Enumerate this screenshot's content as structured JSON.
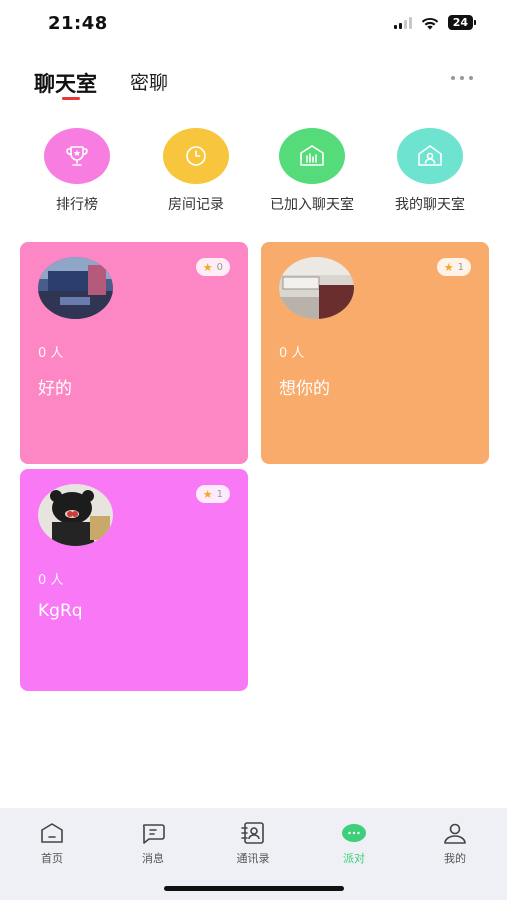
{
  "status_bar": {
    "time": "21:48",
    "battery": "24"
  },
  "header": {
    "tabs": [
      {
        "label": "聊天室"
      },
      {
        "label": "密聊"
      }
    ],
    "more_icon": "more-icon"
  },
  "quick_entries": [
    {
      "label": "排行榜",
      "icon": "trophy-icon",
      "color": "#f77ee0"
    },
    {
      "label": "房间记录",
      "icon": "clock-icon",
      "color": "#f7c63d"
    },
    {
      "label": "已加入聊天室",
      "icon": "chat-room-icon",
      "color": "#55db7a"
    },
    {
      "label": "我的聊天室",
      "icon": "house-user-icon",
      "color": "#6ee3cf"
    }
  ],
  "rooms": [
    {
      "count": "0 人",
      "name": "好的",
      "badge": "0",
      "color": "#fd87c4"
    },
    {
      "count": "0 人",
      "name": "想你的",
      "badge": "1",
      "color": "#f8ab6a"
    },
    {
      "count": "0 人",
      "name": "KgRq",
      "badge": "1",
      "color": "#f878f6"
    }
  ],
  "bottom_nav": [
    {
      "label": "首页",
      "icon": "home-icon"
    },
    {
      "label": "消息",
      "icon": "message-icon"
    },
    {
      "label": "通讯录",
      "icon": "contacts-icon"
    },
    {
      "label": "派对",
      "icon": "party-icon",
      "active": true
    },
    {
      "label": "我的",
      "icon": "profile-icon"
    }
  ]
}
